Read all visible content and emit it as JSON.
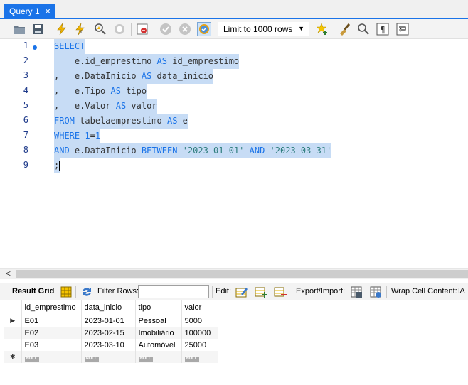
{
  "tab": {
    "label": "Query 1",
    "close": "×"
  },
  "toolbar": {
    "limit_label": "Limit to 1000 rows"
  },
  "editor": {
    "lines": [
      {
        "no": "1",
        "text": "SELECT"
      },
      {
        "no": "2",
        "text": "    e.id_emprestimo AS id_emprestimo"
      },
      {
        "no": "3",
        "text": ",   e.DataInicio AS data_inicio"
      },
      {
        "no": "4",
        "text": ",   e.Tipo AS tipo"
      },
      {
        "no": "5",
        "text": ",   e.Valor AS valor"
      },
      {
        "no": "6",
        "text": "FROM tabelaemprestimo AS e"
      },
      {
        "no": "7",
        "text": "WHERE 1=1"
      },
      {
        "no": "8",
        "text": "AND e.DataInicio BETWEEN '2023-01-01' AND '2023-03-31'"
      },
      {
        "no": "9",
        "text": ";"
      }
    ]
  },
  "results_toolbar": {
    "result_grid": "Result Grid",
    "filter_rows": "Filter Rows:",
    "filter_value": "",
    "edit": "Edit:",
    "export_import": "Export/Import:",
    "wrap_cell": "Wrap Cell Content:",
    "wrap_icon_text": "IA"
  },
  "grid": {
    "columns": [
      "id_emprestimo",
      "data_inicio",
      "tipo",
      "valor"
    ],
    "rows": [
      [
        "E01",
        "2023-01-01",
        "Pessoal",
        "5000"
      ],
      [
        "E02",
        "2023-02-15",
        "Imobiliário",
        "100000"
      ],
      [
        "E03",
        "2023-03-10",
        "Automóvel",
        "25000"
      ]
    ],
    "null_label": "NULL"
  },
  "colors": {
    "accent": "#1a73e8",
    "selection": "#c7dcf5",
    "keyword": "#1a73e8",
    "string": "#2e7d7d"
  }
}
